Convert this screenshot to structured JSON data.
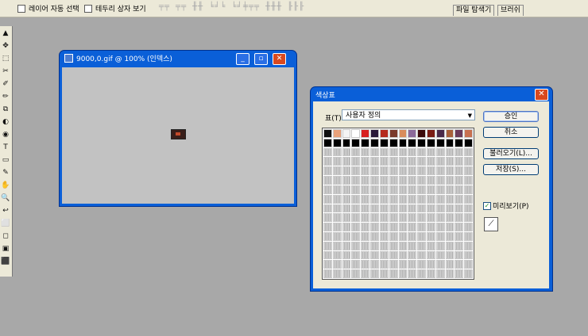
{
  "options_bar": {
    "auto_select_label": "레이어 자동 선택",
    "bounding_box_label": "테두리 상자 보기",
    "align_icons": "╤╤ ╤╤ ╫╫ ╘╛╘ ╘╛╘",
    "distribute_icons": "╤╤╤ ╫╫╫ ╟╟╟"
  },
  "panel_tabs": [
    "파일 탐색기",
    "브러쉬"
  ],
  "tools": [
    "▲",
    "✥",
    "⬚",
    "✂",
    "✐",
    "✏",
    "⧉",
    "◐",
    "◉",
    "T",
    "▭",
    "✎",
    "✋",
    "🔍",
    "↩",
    "⬜",
    "◻",
    "▣",
    "⬛"
  ],
  "document": {
    "title": "9000,0.gif @ 100% (인덱스)"
  },
  "dialog": {
    "title": "색상표",
    "table_label": "표(T):",
    "table_value": "사용자 정의",
    "buttons": {
      "ok": "승인",
      "cancel": "취소",
      "load": "불러오기(L)...",
      "save": "저장(S)..."
    },
    "preview_label": "미리보기(P)",
    "swatches_row1": [
      "#101010",
      "#e8a17a",
      "#f4f4f4",
      "#ffffff",
      "#d82020",
      "#2a1a3a",
      "#b52a1e",
      "#7a3a2c",
      "#d98c5c",
      "#8c6a9a",
      "#3c0a0a",
      "#7a1c14",
      "#4a2a4a",
      "#a8603a",
      "#6a3a5a",
      "#c87050"
    ],
    "swatches_row2_color": "#000000",
    "empty_cell_color": "#bdbdbd"
  }
}
